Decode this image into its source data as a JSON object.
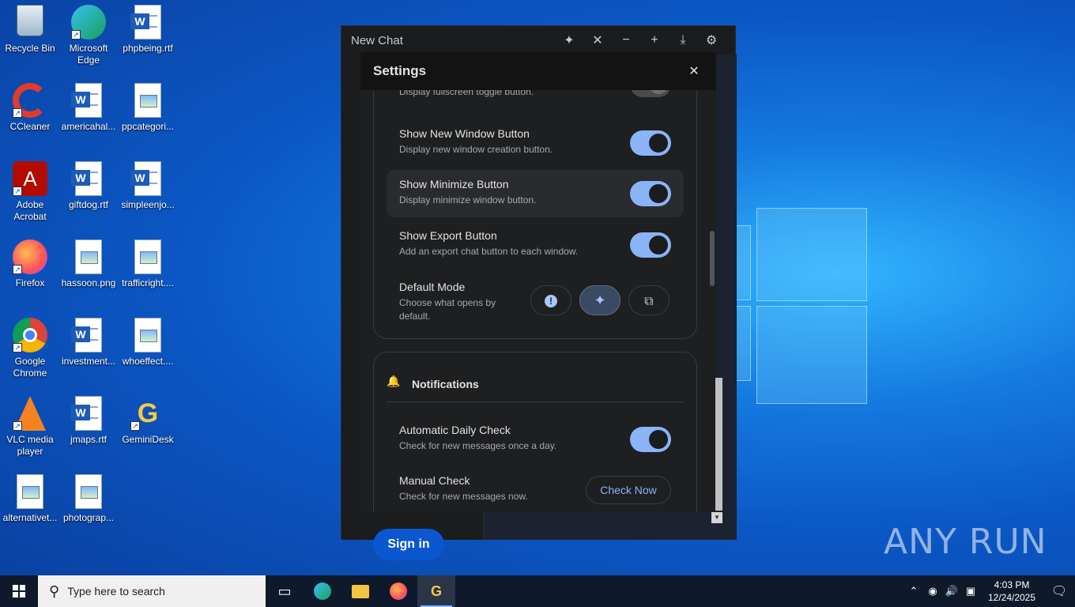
{
  "desktop": {
    "icons": [
      {
        "label": "Recycle Bin",
        "icon": "recycle-bin-icon"
      },
      {
        "label": "Microsoft Edge",
        "icon": "edge-icon"
      },
      {
        "label": "phpbeing.rtf",
        "icon": "word-doc-icon"
      },
      {
        "label": "CCleaner",
        "icon": "ccleaner-icon"
      },
      {
        "label": "americahal...",
        "icon": "word-doc-icon"
      },
      {
        "label": "ppcategori...",
        "icon": "image-file-icon"
      },
      {
        "label": "Adobe Acrobat",
        "icon": "acrobat-icon"
      },
      {
        "label": "giftdog.rtf",
        "icon": "word-doc-icon"
      },
      {
        "label": "simpleenjo...",
        "icon": "word-doc-icon"
      },
      {
        "label": "Firefox",
        "icon": "firefox-icon"
      },
      {
        "label": "hassoon.png",
        "icon": "image-file-icon"
      },
      {
        "label": "trafficright....",
        "icon": "image-file-icon"
      },
      {
        "label": "Google Chrome",
        "icon": "chrome-icon"
      },
      {
        "label": "investment...",
        "icon": "word-doc-icon"
      },
      {
        "label": "whoeffect....",
        "icon": "image-file-icon"
      },
      {
        "label": "VLC media player",
        "icon": "vlc-icon"
      },
      {
        "label": "jmaps.rtf",
        "icon": "word-doc-icon"
      },
      {
        "label": "GeminiDesk",
        "icon": "geminidesk-icon"
      },
      {
        "label": "alternativet...",
        "icon": "image-file-icon"
      },
      {
        "label": "photograp...",
        "icon": "image-file-icon"
      }
    ]
  },
  "app": {
    "title": "New Chat",
    "signin_label": "Sign in"
  },
  "settings": {
    "title": "Settings",
    "partial_row_desc": "Display fullscreen toggle button.",
    "rows": [
      {
        "title": "Show New Window Button",
        "desc": "Display new window creation button.",
        "on": true
      },
      {
        "title": "Show Minimize Button",
        "desc": "Display minimize window button.",
        "on": true
      },
      {
        "title": "Show Export Button",
        "desc": "Add an export chat button to each window.",
        "on": true
      }
    ],
    "default_mode": {
      "title": "Default Mode",
      "desc": "Choose what opens by default.",
      "options": [
        "alert-icon",
        "sparkle-icon",
        "new-chat-icon"
      ],
      "selected_index": 1
    },
    "notifications": {
      "heading": "Notifications",
      "auto_title": "Automatic Daily Check",
      "auto_desc": "Check for new messages once a day.",
      "auto_on": true,
      "manual_title": "Manual Check",
      "manual_desc": "Check for new messages now.",
      "check_now_label": "Check Now"
    }
  },
  "taskbar": {
    "search_placeholder": "Type here to search",
    "time": "4:03 PM",
    "date": "12/24/2025"
  },
  "watermark": "ANY RUN",
  "colors": {
    "accent": "#8ab4f8",
    "dialog_bg": "#1e1f21",
    "desktop_blue": "#0b57c4"
  }
}
